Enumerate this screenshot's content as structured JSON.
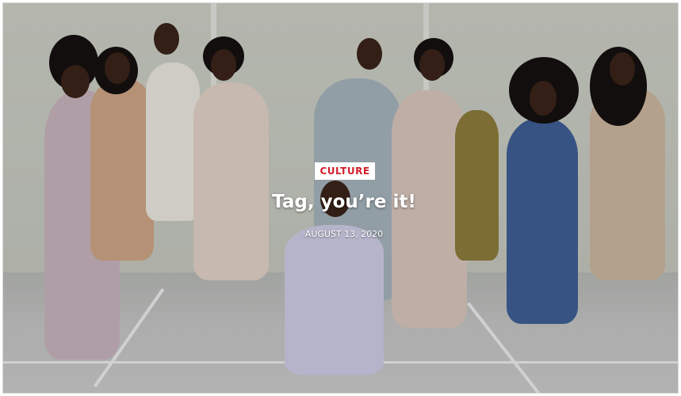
{
  "post": {
    "category": "CULTURE",
    "title": "Tag, you’re it!",
    "date": "AUGUST 13, 2020"
  },
  "colors": {
    "category_text": "#d11f2b",
    "category_bg": "#ffffff",
    "title_text": "#ffffff"
  }
}
